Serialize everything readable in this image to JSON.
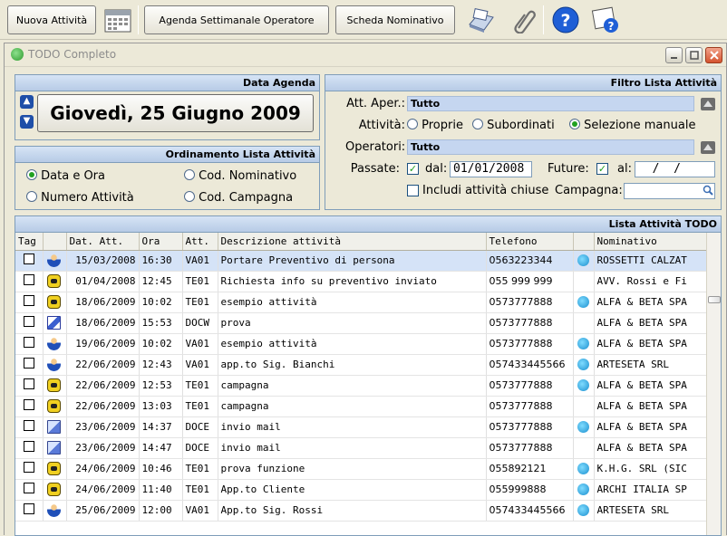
{
  "toolbar": {
    "new_activity": "Nuova Attività",
    "weekly_agenda": "Agenda Settimanale Operatore",
    "contact_sheet": "Scheda Nominativo"
  },
  "window": {
    "title": "TODO Completo"
  },
  "agenda": {
    "header": "Data Agenda",
    "date_label": "Giovedì, 25 Giugno 2009"
  },
  "sorting": {
    "header": "Ordinamento Lista Attività",
    "options": [
      "Data e Ora",
      "Cod. Nominativo",
      "Numero Attività",
      "Cod. Campagna"
    ],
    "selected": "Data e Ora"
  },
  "filter": {
    "header": "Filtro Lista Attività",
    "open_label": "Att. Aper.:",
    "open_value": "Tutto",
    "activity_label": "Attività:",
    "activity_options": [
      "Proprie",
      "Subordinati",
      "Selezione manuale"
    ],
    "activity_selected": "Selezione manuale",
    "operators_label": "Operatori:",
    "operators_value": "Tutto",
    "past_label": "Passate:",
    "from_label": "dal:",
    "from_value": "01/01/2008",
    "future_label": "Future:",
    "to_label": "al:",
    "to_value": "  /  /",
    "include_closed_label": "Includi attività chiuse",
    "campaign_label": "Campagna:",
    "campaign_value": ""
  },
  "list": {
    "header": "Lista Attività TODO",
    "columns": [
      "Tag",
      "",
      "Dat. Att.",
      "Ora",
      "Att.",
      "Descrizione attività",
      "Telefono",
      "",
      "Nominativo"
    ],
    "rows": [
      {
        "icon": "person-icon",
        "date": "15/03/2008",
        "time": "16:30",
        "code": "VA01",
        "desc": "Portare Preventivo di persona",
        "phone": "0563223344",
        "tel": true,
        "name": "ROSSETTI CALZAT"
      },
      {
        "icon": "phone-icon",
        "date": "01/04/2008",
        "time": "12:45",
        "code": "TE01",
        "desc": "Richiesta info su preventivo inviato",
        "phone": "055 999 999",
        "tel": false,
        "name": "AVV. Rossi e Fi"
      },
      {
        "icon": "phone-icon",
        "date": "18/06/2009",
        "time": "10:02",
        "code": "TE01",
        "desc": "esempio attività",
        "phone": "0573777888",
        "tel": true,
        "name": "ALFA & BETA SPA"
      },
      {
        "icon": "document-icon",
        "date": "18/06/2009",
        "time": "15:53",
        "code": "DOCW",
        "desc": "prova",
        "phone": "0573777888",
        "tel": false,
        "name": "ALFA & BETA SPA"
      },
      {
        "icon": "person-icon",
        "date": "19/06/2009",
        "time": "10:02",
        "code": "VA01",
        "desc": "esempio attività",
        "phone": "0573777888",
        "tel": true,
        "name": "ALFA & BETA SPA"
      },
      {
        "icon": "person-icon",
        "date": "22/06/2009",
        "time": "12:43",
        "code": "VA01",
        "desc": "app.to Sig. Bianchi",
        "phone": "057433445566",
        "tel": true,
        "name": "ARTESETA SRL"
      },
      {
        "icon": "phone-icon",
        "date": "22/06/2009",
        "time": "12:53",
        "code": "TE01",
        "desc": "campagna",
        "phone": "0573777888",
        "tel": true,
        "name": "ALFA & BETA SPA"
      },
      {
        "icon": "phone-icon",
        "date": "22/06/2009",
        "time": "13:03",
        "code": "TE01",
        "desc": "campagna",
        "phone": "0573777888",
        "tel": false,
        "name": "ALFA & BETA SPA"
      },
      {
        "icon": "mail-icon",
        "date": "23/06/2009",
        "time": "14:37",
        "code": "DOCE",
        "desc": "invio mail",
        "phone": "0573777888",
        "tel": true,
        "name": "ALFA & BETA SPA"
      },
      {
        "icon": "mail-icon",
        "date": "23/06/2009",
        "time": "14:47",
        "code": "DOCE",
        "desc": "invio mail",
        "phone": "0573777888",
        "tel": false,
        "name": "ALFA & BETA SPA"
      },
      {
        "icon": "phone-icon",
        "date": "24/06/2009",
        "time": "10:46",
        "code": "TE01",
        "desc": "prova funzione",
        "phone": "055892121",
        "tel": true,
        "name": "K.H.G. SRL (SIC"
      },
      {
        "icon": "phone-icon",
        "date": "24/06/2009",
        "time": "11:40",
        "code": "TE01",
        "desc": "App.to Cliente",
        "phone": "055999888",
        "tel": true,
        "name": "ARCHI ITALIA SP"
      },
      {
        "icon": "person-icon",
        "date": "25/06/2009",
        "time": "12:00",
        "code": "VA01",
        "desc": "App.to Sig. Rossi",
        "phone": "057433445566",
        "tel": true,
        "name": "ARTESETA SRL"
      }
    ]
  }
}
